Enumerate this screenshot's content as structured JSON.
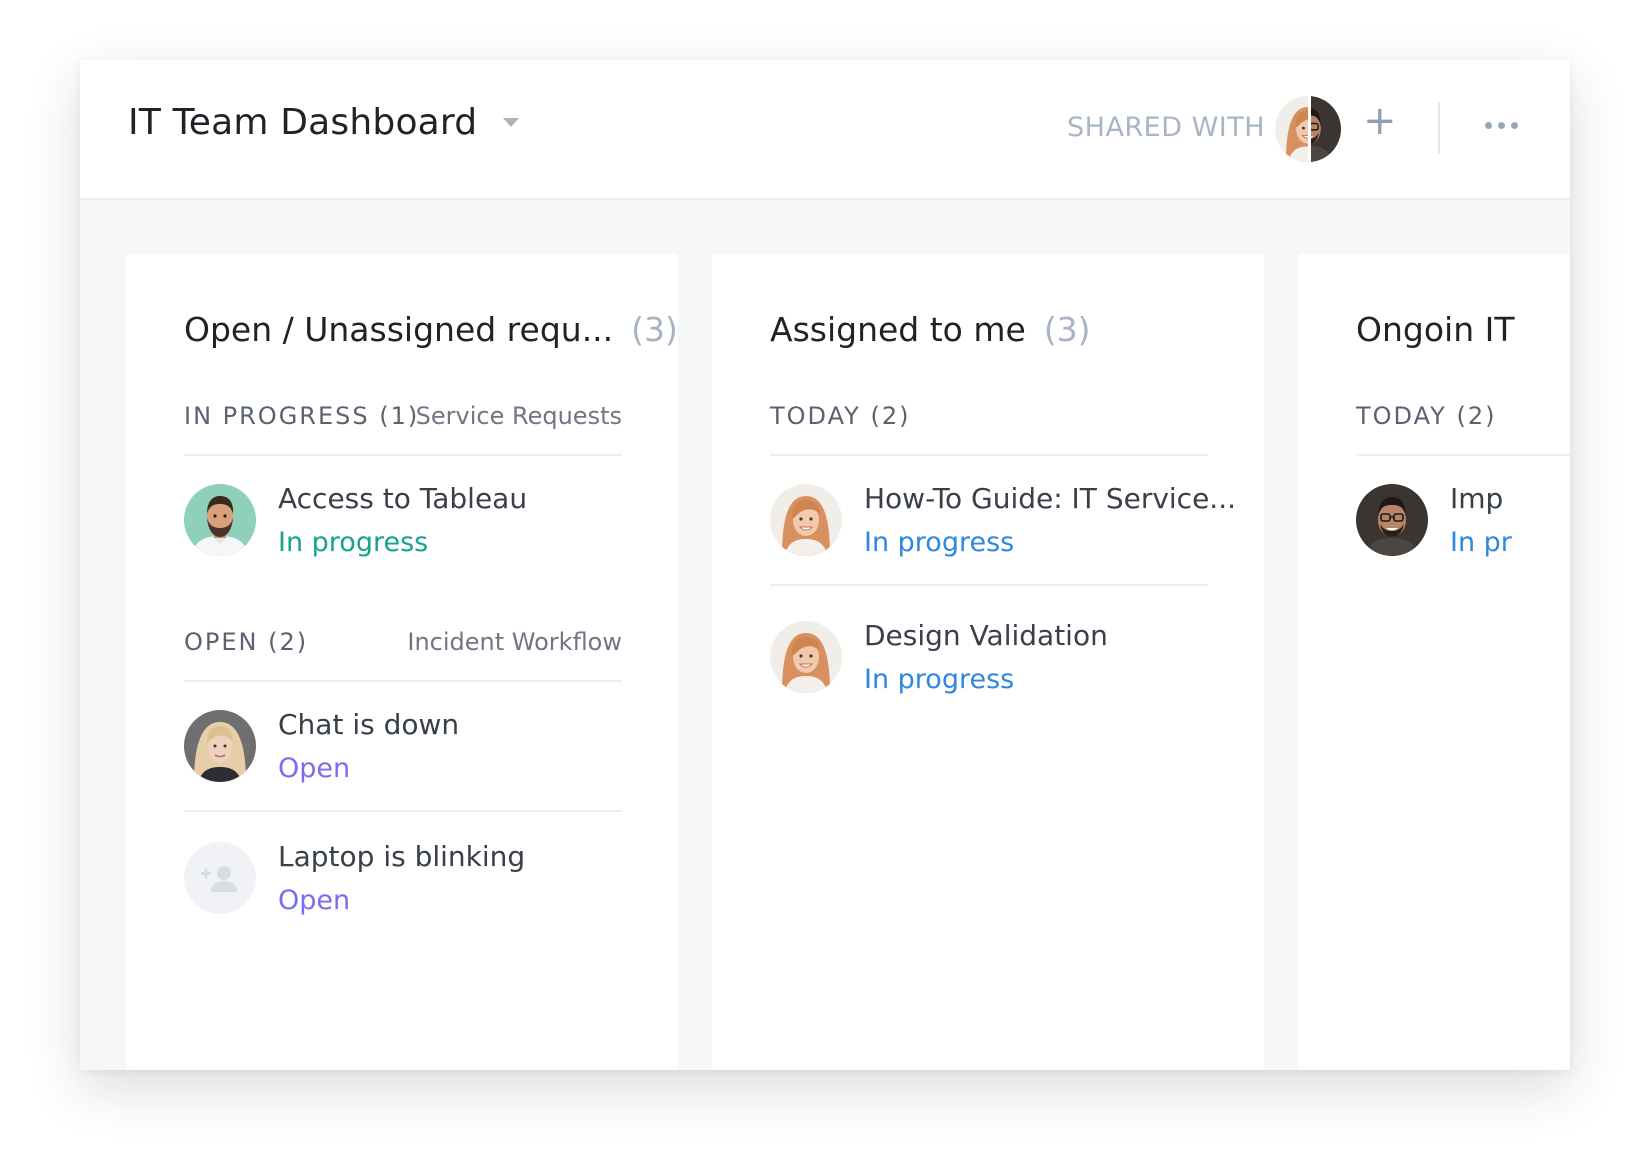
{
  "header": {
    "title": "IT Team Dashboard",
    "shared_with_label": "SHARED WITH"
  },
  "columns": [
    {
      "title": "Open / Unassigned requ...",
      "count": "(3)",
      "groups": [
        {
          "label": "IN PROGRESS (1)",
          "source": "Service Requests",
          "items": [
            {
              "title": "Access to Tableau",
              "status": "In progress"
            }
          ]
        },
        {
          "label": "OPEN (2)",
          "source": "Incident Workflow",
          "items": [
            {
              "title": "Chat is down",
              "status": "Open"
            },
            {
              "title": "Laptop is blinking",
              "status": "Open"
            }
          ]
        }
      ]
    },
    {
      "title": "Assigned to me",
      "count": "(3)",
      "groups": [
        {
          "label": "TODAY (2)",
          "items": [
            {
              "title": "How-To Guide: IT Service...",
              "status": "In progress"
            },
            {
              "title": "Design Validation",
              "status": "In progress"
            }
          ]
        }
      ]
    },
    {
      "title": "Ongoin IT",
      "groups": [
        {
          "label": "TODAY (2)",
          "items": [
            {
              "title": "Imp",
              "status": "In pr"
            }
          ]
        }
      ]
    }
  ],
  "colors": {
    "status_in_progress_green": "#14a58a",
    "status_in_progress_blue": "#2f87e0",
    "status_open": "#7a6cf0",
    "muted_count": "#a8b3c3",
    "shared_label": "#a9b5c6"
  },
  "icons": [
    "chevron-down-icon",
    "plus-icon",
    "more-horizontal-icon",
    "add-user-icon"
  ]
}
